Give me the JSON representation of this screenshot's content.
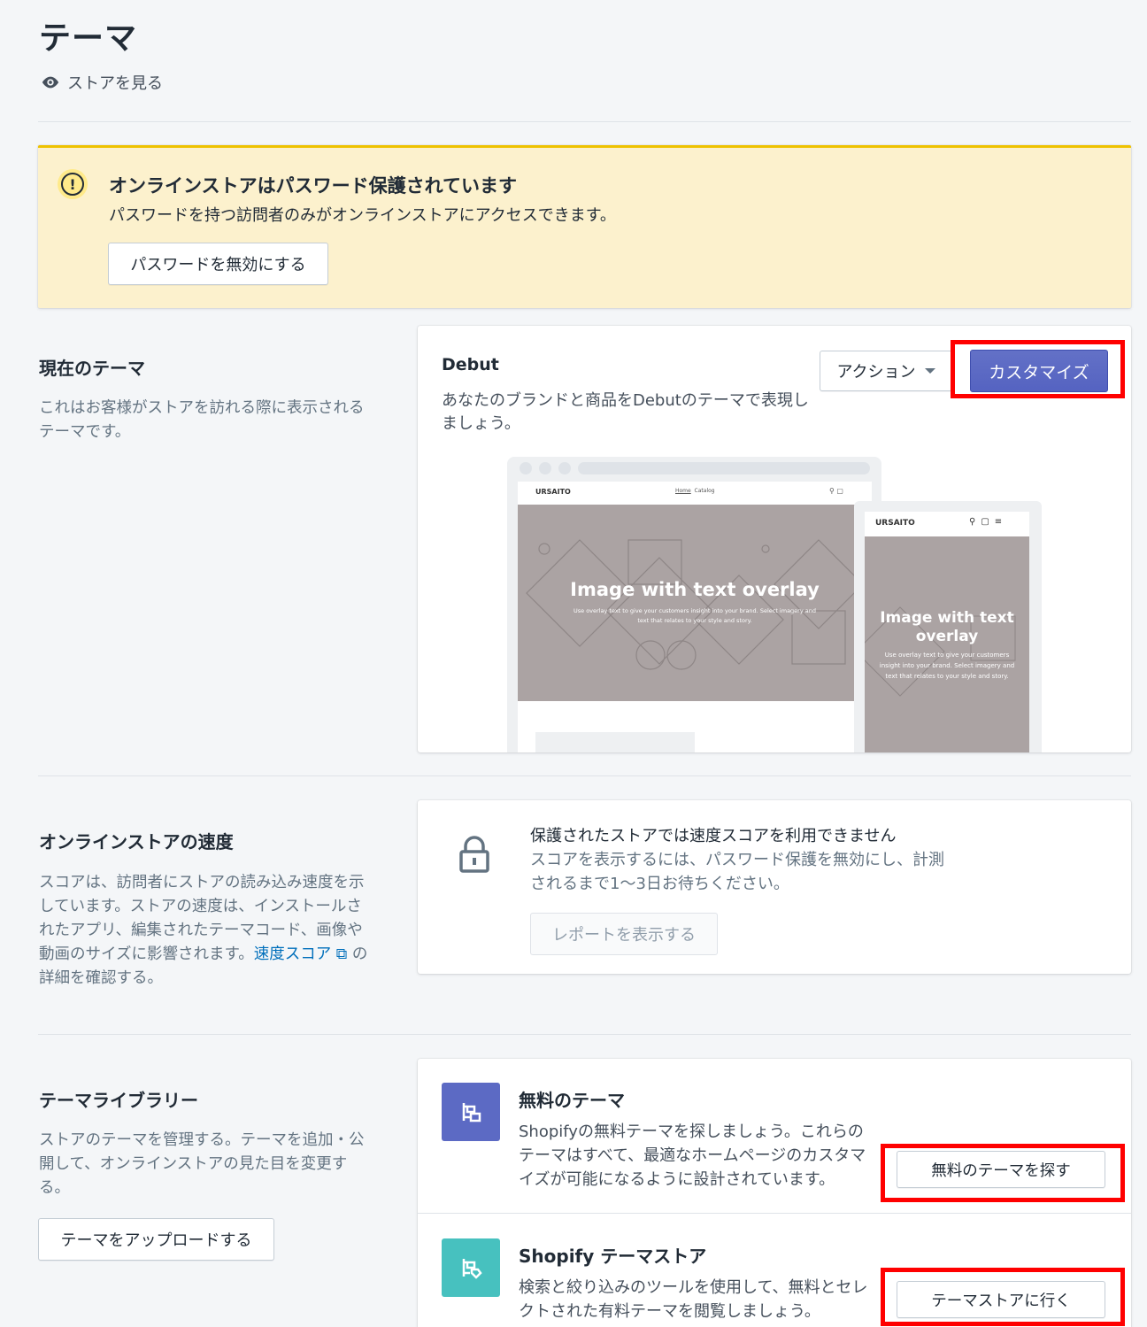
{
  "header": {
    "title": "テーマ",
    "view_store": "ストアを見る"
  },
  "banner": {
    "title": "オンラインストアはパスワード保護されています",
    "text": "パスワードを持つ訪問者のみがオンラインストアにアクセスできます。",
    "button": "パスワードを無効にする"
  },
  "current_theme": {
    "section_title": "現在のテーマ",
    "section_desc": "これはお客様がストアを訪れる際に表示されるテーマです。",
    "theme_name": "Debut",
    "theme_desc": "あなたのブランドと商品をDebutのテーマで表現しましょう。",
    "action_button": "アクション",
    "customize_button": "カスタマイズ",
    "preview": {
      "brand": "URSAITO",
      "nav": [
        "Home",
        "Catalog"
      ],
      "hero_title": "Image with text overlay",
      "hero_text": "Use overlay text to give your customers insight into your brand. Select imagery and text that relates to your style and story.",
      "mobile_hero_title": "Image with text overlay",
      "mobile_hero_text": "Use overlay text to give your customers insight into your brand. Select imagery and text that relates to your style and story."
    }
  },
  "speed": {
    "section_title": "オンラインストアの速度",
    "section_desc_1": "スコアは、訪問者にストアの読み込み速度を示しています。ストアの速度は、インストールされたアプリ、編集されたテーマコード、画像や動画のサイズに影響されます。",
    "section_link": "速度スコア",
    "section_desc_2": " の詳細を確認する。",
    "card_title": "保護されたストアでは速度スコアを利用できません",
    "card_desc": "スコアを表示するには、パスワード保護を無効にし、計測されるまで1〜3日お待ちください。",
    "report_button": "レポートを表示する"
  },
  "library": {
    "section_title": "テーマライブラリー",
    "section_desc": "ストアのテーマを管理する。テーマを追加・公開して、オンラインストアの見た目を変更する。",
    "upload_button": "テーマをアップロードする",
    "free": {
      "title": "無料のテーマ",
      "desc": "Shopifyの無料テーマを探しましょう。これらのテーマはすべて、最適なホームページのカスタマイズが可能になるように設計されています。",
      "button": "無料のテーマを探す"
    },
    "store": {
      "title": "Shopify テーマストア",
      "desc": "検索と絞り込みのツールを使用して、無料とセレクトされた有料テーマを閲覧しましょう。",
      "button": "テーマストアに行く"
    }
  },
  "colors": {
    "primary": "#5c6ac4",
    "warning": "#eec200",
    "highlight": "#ff0000",
    "free_icon_bg": "#5c6ac4",
    "store_icon_bg": "#47c1bf"
  }
}
